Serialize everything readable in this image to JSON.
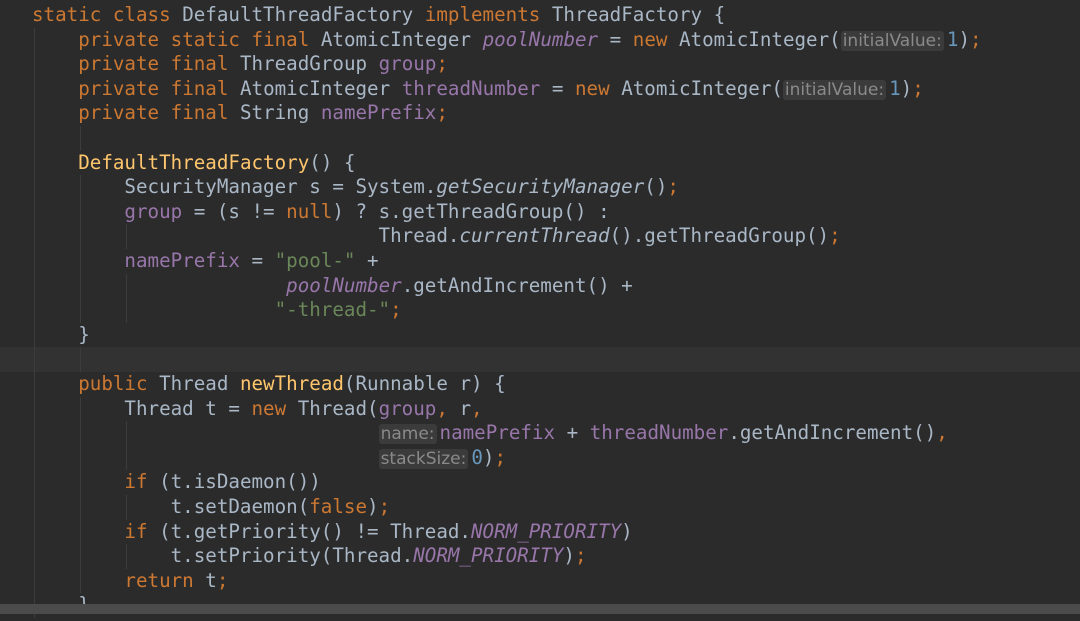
{
  "lines": [
    [
      {
        "t": "static",
        "c": "kw"
      },
      {
        "t": " "
      },
      {
        "t": "class",
        "c": "kw"
      },
      {
        "t": " DefaultThreadFactory "
      },
      {
        "t": "implements",
        "c": "kw"
      },
      {
        "t": " ThreadFactory {"
      }
    ],
    [
      {
        "t": "    "
      },
      {
        "t": "private",
        "c": "kw"
      },
      {
        "t": " "
      },
      {
        "t": "static",
        "c": "kw"
      },
      {
        "t": " "
      },
      {
        "t": "final",
        "c": "kw"
      },
      {
        "t": " AtomicInteger "
      },
      {
        "t": "poolNumber",
        "c": "sfld"
      },
      {
        "t": " = "
      },
      {
        "t": "new",
        "c": "kw"
      },
      {
        "t": " AtomicInteger("
      },
      {
        "t": "initialValue:",
        "c": "hint"
      },
      {
        "t": "1",
        "c": "num"
      },
      {
        "t": ")"
      },
      {
        "t": ";",
        "c": "kw"
      }
    ],
    [
      {
        "t": "    "
      },
      {
        "t": "private",
        "c": "kw"
      },
      {
        "t": " "
      },
      {
        "t": "final",
        "c": "kw"
      },
      {
        "t": " ThreadGroup "
      },
      {
        "t": "group",
        "c": "fld"
      },
      {
        "t": ";",
        "c": "kw"
      }
    ],
    [
      {
        "t": "    "
      },
      {
        "t": "private",
        "c": "kw"
      },
      {
        "t": " "
      },
      {
        "t": "final",
        "c": "kw"
      },
      {
        "t": " AtomicInteger "
      },
      {
        "t": "threadNumber",
        "c": "fld"
      },
      {
        "t": " = "
      },
      {
        "t": "new",
        "c": "kw"
      },
      {
        "t": " AtomicInteger("
      },
      {
        "t": "initialValue:",
        "c": "hint"
      },
      {
        "t": "1",
        "c": "num"
      },
      {
        "t": ")"
      },
      {
        "t": ";",
        "c": "kw"
      }
    ],
    [
      {
        "t": "    "
      },
      {
        "t": "private",
        "c": "kw"
      },
      {
        "t": " "
      },
      {
        "t": "final",
        "c": "kw"
      },
      {
        "t": " String "
      },
      {
        "t": "namePrefix",
        "c": "fld"
      },
      {
        "t": ";",
        "c": "kw"
      }
    ],
    [],
    [
      {
        "t": "    "
      },
      {
        "t": "DefaultThreadFactory",
        "c": "mth"
      },
      {
        "t": "() {"
      }
    ],
    [
      {
        "t": "        SecurityManager s = System."
      },
      {
        "t": "getSecurityManager",
        "c": "smth"
      },
      {
        "t": "()"
      },
      {
        "t": ";",
        "c": "kw"
      }
    ],
    [
      {
        "t": "        "
      },
      {
        "t": "group",
        "c": "fld"
      },
      {
        "t": " = (s != "
      },
      {
        "t": "null",
        "c": "kw"
      },
      {
        "t": ") ? s.getThreadGroup() :"
      }
    ],
    [
      {
        "t": "                              Thread."
      },
      {
        "t": "currentThread",
        "c": "smth"
      },
      {
        "t": "().getThreadGroup()"
      },
      {
        "t": ";",
        "c": "kw"
      }
    ],
    [
      {
        "t": "        "
      },
      {
        "t": "namePrefix",
        "c": "fld"
      },
      {
        "t": " = "
      },
      {
        "t": "\"pool-\"",
        "c": "str"
      },
      {
        "t": " +"
      }
    ],
    [
      {
        "t": "                      "
      },
      {
        "t": "poolNumber",
        "c": "sfld"
      },
      {
        "t": ".getAndIncrement() +"
      }
    ],
    [
      {
        "t": "                     "
      },
      {
        "t": "\"-thread-\"",
        "c": "str"
      },
      {
        "t": ";",
        "c": "kw"
      }
    ],
    [
      {
        "t": "    }"
      }
    ],
    [],
    [
      {
        "t": "    "
      },
      {
        "t": "public",
        "c": "kw"
      },
      {
        "t": " Thread "
      },
      {
        "t": "newThread",
        "c": "mth"
      },
      {
        "t": "(Runnable r) {"
      }
    ],
    [
      {
        "t": "        Thread t = "
      },
      {
        "t": "new",
        "c": "kw"
      },
      {
        "t": " Thread("
      },
      {
        "t": "group",
        "c": "fld"
      },
      {
        "t": ", ",
        "c": "kw"
      },
      {
        "t": "r"
      },
      {
        "t": ",",
        "c": "kw"
      }
    ],
    [
      {
        "t": "                              "
      },
      {
        "t": "name:",
        "c": "hint"
      },
      {
        "t": "namePrefix",
        "c": "fld"
      },
      {
        "t": " + "
      },
      {
        "t": "threadNumber",
        "c": "fld"
      },
      {
        "t": ".getAndIncrement()"
      },
      {
        "t": ",",
        "c": "kw"
      }
    ],
    [
      {
        "t": "                              "
      },
      {
        "t": "stackSize:",
        "c": "hint"
      },
      {
        "t": "0",
        "c": "num"
      },
      {
        "t": ")"
      },
      {
        "t": ";",
        "c": "kw"
      }
    ],
    [
      {
        "t": "        "
      },
      {
        "t": "if",
        "c": "kw"
      },
      {
        "t": " (t.isDaemon())"
      }
    ],
    [
      {
        "t": "            t.setDaemon("
      },
      {
        "t": "false",
        "c": "kw"
      },
      {
        "t": ")"
      },
      {
        "t": ";",
        "c": "kw"
      }
    ],
    [
      {
        "t": "        "
      },
      {
        "t": "if",
        "c": "kw"
      },
      {
        "t": " (t.getPriority() != Thread."
      },
      {
        "t": "NORM_PRIORITY",
        "c": "sfld"
      },
      {
        "t": ")"
      }
    ],
    [
      {
        "t": "            t.setPriority(Thread."
      },
      {
        "t": "NORM_PRIORITY",
        "c": "sfld"
      },
      {
        "t": ")"
      },
      {
        "t": ";",
        "c": "kw"
      }
    ],
    [
      {
        "t": "        "
      },
      {
        "t": "return",
        "c": "kw"
      },
      {
        "t": " t"
      },
      {
        "t": ";",
        "c": "kw"
      }
    ],
    [
      {
        "t": "    }"
      }
    ]
  ],
  "current_line": 14,
  "colors": {
    "background": "#2b2b2b",
    "current_line": "#323232",
    "keyword": "#cc7832",
    "field": "#9876aa",
    "method_decl": "#ffc66d",
    "string": "#6a8759",
    "number": "#6897bb",
    "text": "#a9b7c6",
    "hint_bg": "#3b3b3b",
    "hint_fg": "#8a8a8a"
  }
}
